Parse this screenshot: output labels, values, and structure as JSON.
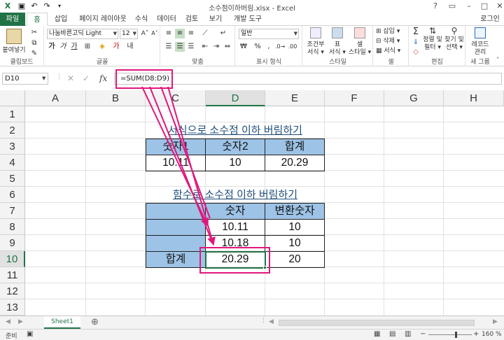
{
  "window": {
    "title": "소수점이하버림.xlsx - Excel",
    "user": "로그인"
  },
  "tabs": [
    {
      "label": "파일"
    },
    {
      "label": "홈"
    },
    {
      "label": "삽입"
    },
    {
      "label": "페이지 레이아웃"
    },
    {
      "label": "수식"
    },
    {
      "label": "데이터"
    },
    {
      "label": "검토"
    },
    {
      "label": "보기"
    },
    {
      "label": "개발 도구"
    }
  ],
  "ribbon": {
    "clipboard": {
      "paste": "붙여넣기",
      "label": "클립보드"
    },
    "font": {
      "name": "나눔바른고딕 Light",
      "size": "12",
      "label": "글꼴"
    },
    "alignment": {
      "label": "맞춤"
    },
    "number": {
      "format": "일반",
      "label": "표시 형식"
    },
    "styles": {
      "conditional": "조건부",
      "conditional2": "서식 ▾",
      "table": "표",
      "table2": "서식 ▾",
      "cell": "셀",
      "cell2": "스타일 ▾",
      "label": "스타일"
    },
    "cells": {
      "insert": "삽입",
      "delete": "삭제",
      "format": "서식",
      "label": "셀"
    },
    "editing": {
      "sort": "정렬 및",
      "sort2": "필터 ▾",
      "find": "찾기 및",
      "find2": "선택 ▾",
      "label": "편집"
    },
    "new": {
      "record": "레코드",
      "record2": "관리",
      "label": "새 그룹"
    }
  },
  "formula_bar": {
    "name_box": "D10",
    "formula": "=SUM(D8:D9)"
  },
  "columns": [
    "A",
    "B",
    "C",
    "D",
    "E",
    "F",
    "G",
    "H"
  ],
  "rows": [
    "1",
    "2",
    "3",
    "4",
    "5",
    "6",
    "7",
    "8",
    "9",
    "10",
    "11",
    "12",
    "13"
  ],
  "sheet": {
    "title1": "서식으로 소수점 이하 버림하기",
    "table1_headers": [
      "숫자1",
      "숫자2",
      "합계"
    ],
    "table1_values": [
      "10.11",
      "10",
      "20.29"
    ],
    "title2": "함수로 소수점 이하 버림하기",
    "table2_headers": [
      "",
      "숫자",
      "변환숫자"
    ],
    "table2_rows": [
      [
        "",
        "10.11",
        "10"
      ],
      [
        "",
        "10.18",
        "10"
      ],
      [
        "합계",
        "20.29",
        "20"
      ]
    ]
  },
  "sheet_tab": "Sheet1",
  "status": {
    "ready": "준비",
    "zoom": "160 %"
  },
  "colors": {
    "excel_green": "#217346",
    "header_blue": "#9dc3e6",
    "annotation": "#e0187c"
  }
}
